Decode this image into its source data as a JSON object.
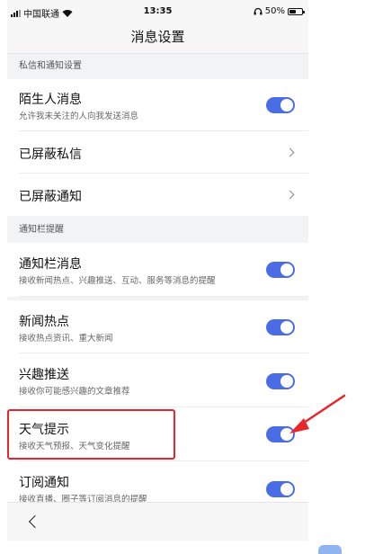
{
  "status_bar": {
    "carrier": "中国联通",
    "time": "13:35",
    "battery_text": "50%",
    "battery_level": 0.5
  },
  "nav": {
    "title": "消息设置"
  },
  "sections": [
    {
      "header": "私信和通知设置"
    },
    {
      "header": "通知栏提醒"
    }
  ],
  "rows": {
    "stranger": {
      "title": "陌生人消息",
      "subtitle": "允许我未关注的人向我发送消息",
      "enabled": true
    },
    "blocked_dm": {
      "title": "已屏蔽私信"
    },
    "blocked_notice": {
      "title": "已屏蔽通知"
    },
    "notify_bar": {
      "title": "通知栏消息",
      "subtitle": "接收新闻热点、兴趣推送、互动、服务等消息的提醒",
      "enabled": true
    },
    "hot_news": {
      "title": "新闻热点",
      "subtitle": "接收热点资讯、重大新闻",
      "enabled": true
    },
    "interest": {
      "title": "兴趣推送",
      "subtitle": "接收你可能感兴趣的文章推荐",
      "enabled": true
    },
    "weather": {
      "title": "天气提示",
      "subtitle": "接收天气预报、天气变化提醒",
      "enabled": true
    },
    "subscribe": {
      "title": "订阅通知",
      "subtitle": "接收直播、圈子等订阅消息的提醒",
      "enabled": true
    }
  },
  "colors": {
    "toggle_on": "#4a6de5",
    "annotation_red": "#e8262d"
  },
  "icons": {
    "back": "chevron-left-icon",
    "disclosure": "chevron-right-icon",
    "wifi": "wifi-icon",
    "signal": "signal-icon",
    "headphones": "headphones-icon",
    "battery": "battery-icon"
  }
}
